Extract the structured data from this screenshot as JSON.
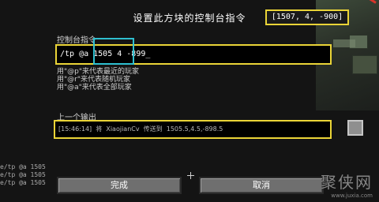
{
  "window": {
    "title": "设置此方块的控制台指令"
  },
  "coords_display": "[1507, 4, -900]",
  "console": {
    "label": "控制台指令",
    "command_value": "/tp @a 1505 4 -899_"
  },
  "hints": [
    "用\"@p\"来代表最近的玩家",
    "用\"@r\"来代表随机玩家",
    "用\"@a\"来代表全部玩家"
  ],
  "previous_output": {
    "label": "上一个输出",
    "text": "[15:46:14]  将  XiaojianCv  传送到  1505.5,4.5,-898.5"
  },
  "chat_lines": [
    "e/tp @a 1505",
    "e/tp @a 1505",
    "e/tp @a 1505"
  ],
  "buttons": {
    "done": "完成",
    "cancel": "取消"
  },
  "watermark": {
    "main": "聚侠网",
    "url": "www.juxia.com"
  },
  "colors": {
    "highlight_yellow": "#ead437",
    "highlight_cyan": "#2fbfcf"
  }
}
